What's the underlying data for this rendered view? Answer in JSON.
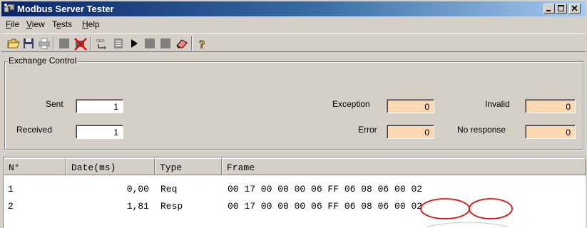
{
  "window": {
    "title": "Modbus Server Tester",
    "controls": {
      "minimize": "minimize",
      "maximize": "maximize",
      "close": "close"
    }
  },
  "menu": {
    "items": [
      {
        "label": "File",
        "accel": "F",
        "rest": "ile"
      },
      {
        "label": "View",
        "accel": "V",
        "rest": "iew"
      },
      {
        "label": "Tests",
        "pre": "T",
        "accel": "e",
        "rest": "sts"
      },
      {
        "label": "Help",
        "accel": "H",
        "rest": "elp"
      }
    ]
  },
  "toolbar": {
    "icons": [
      "open-folder-icon",
      "save-disk-icon",
      "print-icon",
      "stop-icon",
      "network-disconnect-icon",
      "modbus-exchange-icon",
      "list-icon",
      "play-icon",
      "square-icon",
      "square-icon",
      "eraser-icon",
      "help-question-icon"
    ]
  },
  "exchange_control": {
    "title": "Exchange Control",
    "sent_label": "Sent",
    "sent_value": "1",
    "received_label": "Received",
    "received_value": "1",
    "exception_label": "Exception",
    "exception_value": "0",
    "error_label": "Error",
    "error_value": "0",
    "invalid_label": "Invalid",
    "invalid_value": "0",
    "no_response_label": "No response",
    "no_response_value": "0",
    "counter_color": "#fcd8b0"
  },
  "table": {
    "columns": [
      "N°",
      "Date(ms)",
      "Type",
      "Frame"
    ],
    "rows": [
      {
        "n": "1",
        "date": "0,00",
        "type": "Req",
        "frame": "00 17 00 00 00 06 FF 06 08 06 00 02"
      },
      {
        "n": "2",
        "date": "1,81",
        "type": "Resp",
        "frame": "00 17 00 00 00 06 FF 06 08 06 00 02"
      }
    ],
    "highlight_color": "#e01010"
  }
}
